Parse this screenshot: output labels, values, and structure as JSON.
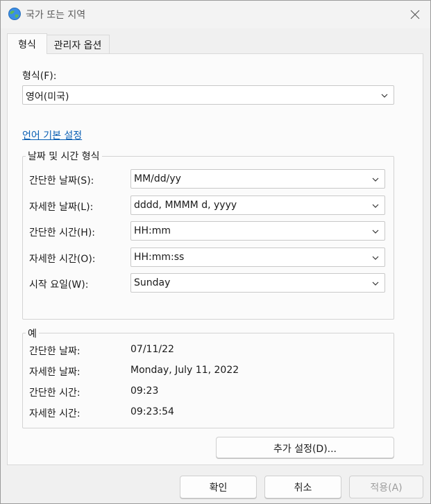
{
  "window": {
    "title": "국가 또는 지역"
  },
  "tabs": [
    {
      "label": "형식",
      "active": true
    },
    {
      "label": "관리자 옵션",
      "active": false
    }
  ],
  "format": {
    "label": "형식(F):",
    "value": "영어(미국)"
  },
  "language_link": "언어 기본 설정",
  "datetime_group": {
    "title": "날짜 및 시간 형식",
    "rows": [
      {
        "label": "간단한 날짜(S):",
        "value": "MM/dd/yy"
      },
      {
        "label": "자세한 날짜(L):",
        "value": "dddd, MMMM d, yyyy"
      },
      {
        "label": "간단한 시간(H):",
        "value": "HH:mm"
      },
      {
        "label": "자세한 시간(O):",
        "value": "HH:mm:ss"
      },
      {
        "label": "시작 요일(W):",
        "value": "Sunday"
      }
    ]
  },
  "examples_group": {
    "title": "예",
    "rows": [
      {
        "label": "간단한 날짜:",
        "value": "07/11/22"
      },
      {
        "label": "자세한 날짜:",
        "value": "Monday, July 11, 2022"
      },
      {
        "label": "간단한 시간:",
        "value": "09:23"
      },
      {
        "label": "자세한 시간:",
        "value": "09:23:54"
      }
    ]
  },
  "buttons": {
    "additional_settings": "추가 설정(D)...",
    "ok": "확인",
    "cancel": "취소",
    "apply": "적용(A)"
  },
  "icons": {
    "app": "globe-icon",
    "close": "close-icon",
    "dropdown": "chevron-down-icon"
  },
  "colors": {
    "link": "#0a5fb4",
    "disabled_text": "#9d9d9d"
  }
}
